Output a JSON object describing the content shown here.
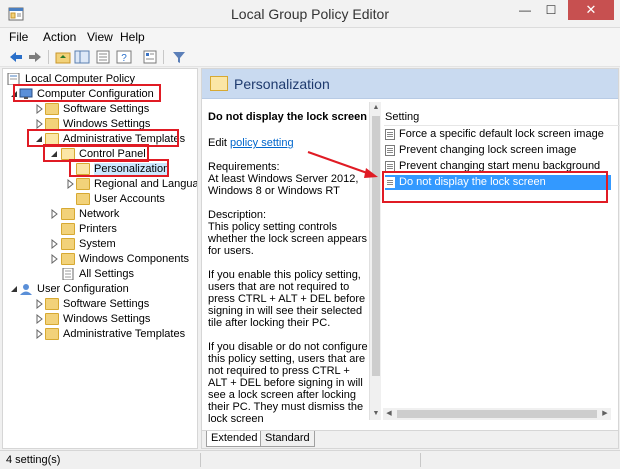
{
  "window": {
    "title": "Local Group Policy Editor",
    "minimize": "—",
    "maximize": "☐",
    "close": "✕"
  },
  "menu": [
    "File",
    "Action",
    "View",
    "Help"
  ],
  "toolbar": {
    "icons": [
      "back-icon",
      "forward-icon",
      "up-folder-icon",
      "show-hide-tree-icon",
      "export-list-icon",
      "help-icon",
      "properties-icon",
      "filter-icon"
    ]
  },
  "tree": {
    "root": "Local Computer Policy",
    "computer_configuration": "Computer Configuration",
    "software_settings": "Software Settings",
    "windows_settings": "Windows Settings",
    "administrative_templates": "Administrative Templates",
    "control_panel": "Control Panel",
    "personalization": "Personalization",
    "regional_and_language": "Regional and Language",
    "user_accounts": "User Accounts",
    "network": "Network",
    "printers": "Printers",
    "system": "System",
    "windows_components": "Windows Components",
    "all_settings": "All Settings",
    "user_configuration": "User Configuration",
    "user_software_settings": "Software Settings",
    "user_windows_settings": "Windows Settings",
    "user_administrative_templates": "Administrative Templates"
  },
  "details": {
    "header": "Personalization",
    "title": "Do not display the lock screen",
    "edit_prefix": "Edit ",
    "edit_link": "policy setting",
    "requirements_label": "Requirements:",
    "requirements_text": "At least Windows Server 2012, Windows 8 or Windows RT",
    "description_label": "Description:",
    "description_p1": "This policy setting controls whether the lock screen appears for users.",
    "description_p2": "If you enable this policy setting, users that are not required to press CTRL + ALT + DEL before signing in will see their selected tile after locking their PC.",
    "description_p3": "If you disable or do not configure this policy setting, users that are not required to press CTRL + ALT + DEL before signing in will see a lock screen after locking their PC. They must dismiss the lock screen"
  },
  "settings": {
    "column_header": "Setting",
    "rows": [
      "Force a specific default lock screen image",
      "Prevent changing lock screen image",
      "Prevent changing start menu background",
      "Do not display the lock screen"
    ]
  },
  "tabs": {
    "extended": "Extended",
    "standard": "Standard"
  },
  "status": "4 setting(s)",
  "colors": {
    "highlight": "#e01b24",
    "selection": "#3399ff",
    "header_band": "#c9daf0"
  }
}
